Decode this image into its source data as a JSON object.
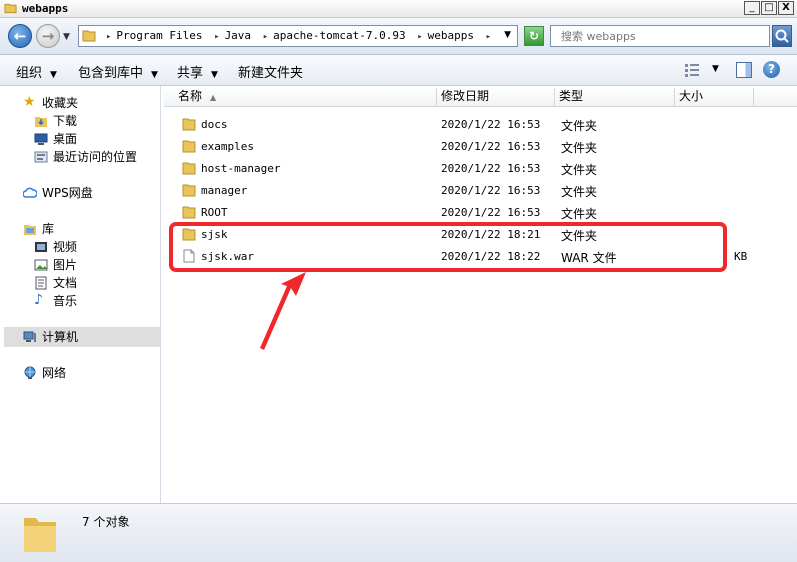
{
  "window": {
    "title": "webapps",
    "btn_min": "_",
    "btn_max": "□",
    "btn_close": "X"
  },
  "addressbar": {
    "crumbs": [
      "Program Files",
      "Java",
      "apache-tomcat-7.0.93",
      "webapps"
    ],
    "search_placeholder": "搜索 webapps"
  },
  "toolbar": {
    "organize": "组织",
    "include_in_library": "包含到库中",
    "share": "共享",
    "new_folder": "新建文件夹"
  },
  "nav": {
    "favorites": "收藏夹",
    "downloads": "下载",
    "desktop": "桌面",
    "recent": "最近访问的位置",
    "wps": "WPS网盘",
    "libraries": "库",
    "videos": "视频",
    "pictures": "图片",
    "documents": "文档",
    "music": "音乐",
    "computer": "计算机",
    "network": "网络"
  },
  "columns": {
    "name": "名称",
    "modified": "修改日期",
    "type": "类型",
    "size": "大小"
  },
  "files": [
    {
      "name": "docs",
      "date": "2020/1/22 16:53",
      "type": "文件夹",
      "size": "",
      "kind": "folder"
    },
    {
      "name": "examples",
      "date": "2020/1/22 16:53",
      "type": "文件夹",
      "size": "",
      "kind": "folder"
    },
    {
      "name": "host-manager",
      "date": "2020/1/22 16:53",
      "type": "文件夹",
      "size": "",
      "kind": "folder"
    },
    {
      "name": "manager",
      "date": "2020/1/22 16:53",
      "type": "文件夹",
      "size": "",
      "kind": "folder"
    },
    {
      "name": "ROOT",
      "date": "2020/1/22 16:53",
      "type": "文件夹",
      "size": "",
      "kind": "folder"
    },
    {
      "name": "sjsk",
      "date": "2020/1/22 18:21",
      "type": "文件夹",
      "size": "",
      "kind": "folder"
    },
    {
      "name": "sjsk.war",
      "date": "2020/1/22 18:22",
      "type": "WAR 文件",
      "size": "KB",
      "kind": "file"
    }
  ],
  "status": {
    "count_text": "7 个对象"
  },
  "colors": {
    "highlight_box": "#f0282c",
    "folder_yellow": "#e8c45a"
  }
}
